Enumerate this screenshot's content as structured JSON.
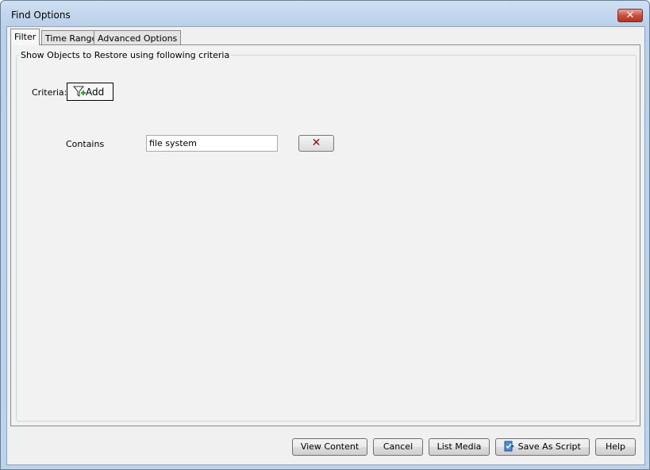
{
  "window": {
    "title": "Find Options",
    "close_icon": "close-icon"
  },
  "tabs": [
    {
      "label": "Filter",
      "active": true
    },
    {
      "label": "Time Range"
    },
    {
      "label": "Advanced Options"
    }
  ],
  "group": {
    "legend": "Show Objects to Restore using following criteria"
  },
  "criteria": {
    "label": "Criteria:",
    "add_label": "Add",
    "add_icon": "filter-add-icon"
  },
  "rule": {
    "label": "Contains",
    "value": "file system",
    "remove_icon": "red-x-icon"
  },
  "buttons": {
    "view_content": "View Content",
    "cancel": "Cancel",
    "list_media": "List Media",
    "save_as_script": "Save As Script",
    "help": "Help"
  }
}
